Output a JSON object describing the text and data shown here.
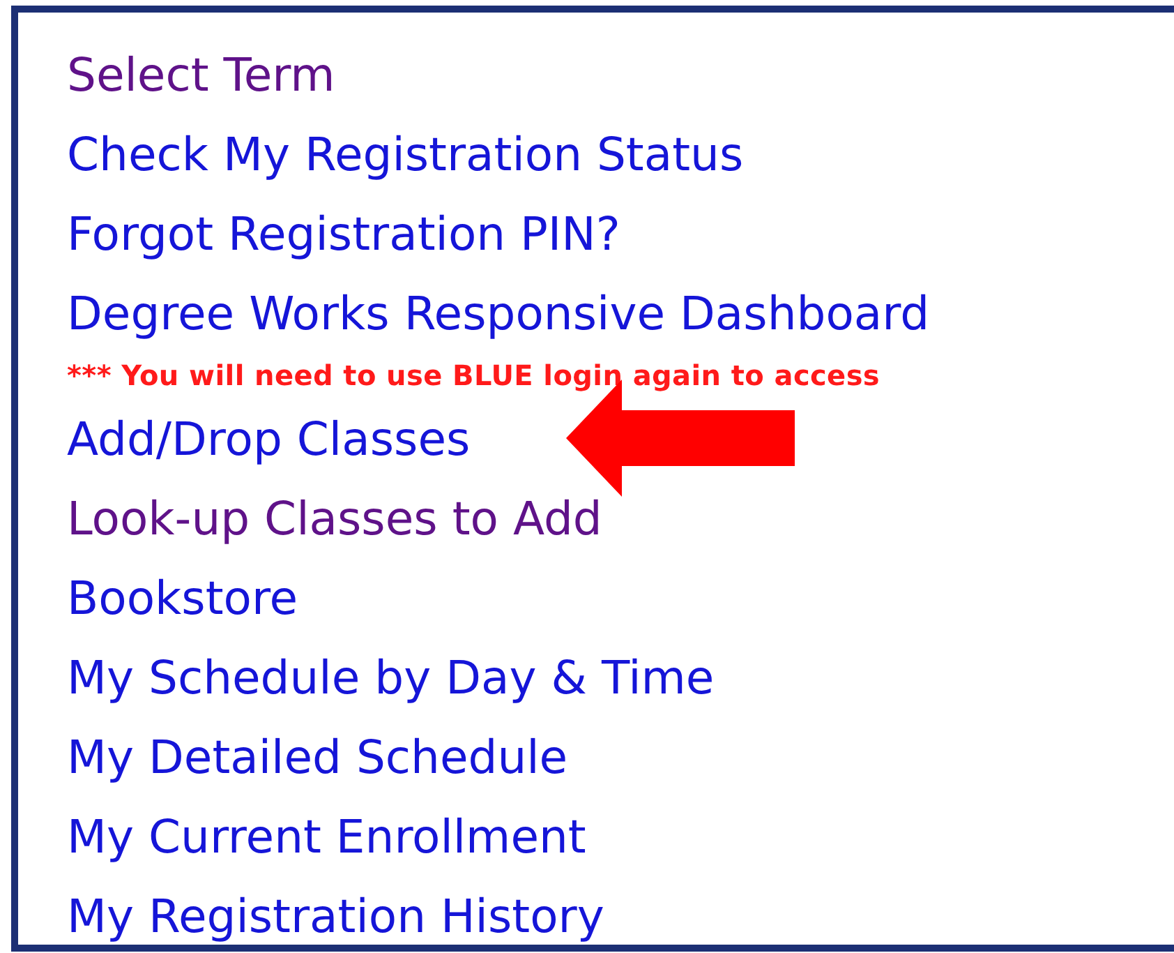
{
  "menu": [
    {
      "kind": "link",
      "label": "Select Term",
      "visited": true
    },
    {
      "kind": "link",
      "label": "Check My Registration Status",
      "visited": false
    },
    {
      "kind": "link",
      "label": "Forgot Registration PIN?",
      "visited": false
    },
    {
      "kind": "link",
      "label": "Degree Works Responsive Dashboard",
      "visited": false
    },
    {
      "kind": "note",
      "label": "*** You will need to use BLUE login again to access"
    },
    {
      "kind": "link",
      "label": "Add/Drop Classes",
      "visited": false,
      "highlighted": true
    },
    {
      "kind": "link",
      "label": "Look-up Classes to Add",
      "visited": true
    },
    {
      "kind": "link",
      "label": "Bookstore",
      "visited": false
    },
    {
      "kind": "link",
      "label": "My Schedule by Day & Time",
      "visited": false
    },
    {
      "kind": "link",
      "label": "My Detailed Schedule",
      "visited": false
    },
    {
      "kind": "link",
      "label": "My Current Enrollment",
      "visited": false
    },
    {
      "kind": "link",
      "label": "My Registration History",
      "visited": false
    }
  ]
}
